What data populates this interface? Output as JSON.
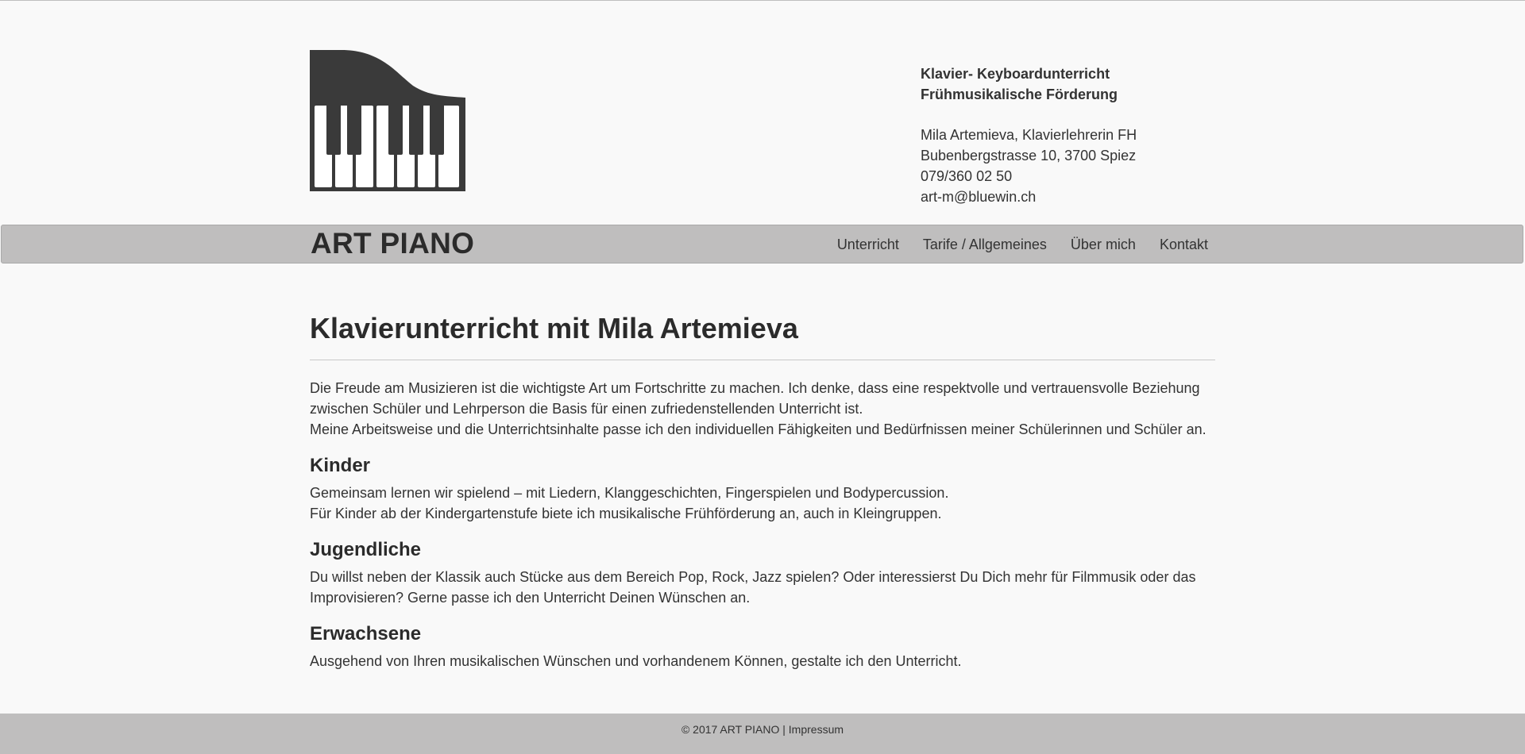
{
  "header": {
    "logo_icon": "grand-piano-icon",
    "contact": {
      "service_line_1": "Klavier- Keyboardunterricht",
      "service_line_2": "Frühmusikalische Förderung",
      "name": "Mila Artemieva, Klavierlehrerin FH",
      "address": "Bubenbergstrasse 10, 3700 Spiez",
      "phone": "079/360 02 50",
      "email": "art-m@bluewin.ch"
    }
  },
  "nav": {
    "brand": "ART PIANO",
    "items": [
      {
        "label": "Unterricht"
      },
      {
        "label": "Tarife / Allgemeines"
      },
      {
        "label": "Über mich"
      },
      {
        "label": "Kontakt"
      }
    ]
  },
  "main": {
    "title": "Klavierunterricht mit Mila Artemieva",
    "intro": [
      "Die Freude am Musizieren ist die wichtigste Art um Fortschritte zu machen. Ich denke, dass eine respektvolle und vertrauensvolle Beziehung zwischen Schüler und Lehrperson die Basis für einen zufriedenstellenden Unterricht ist.",
      "Meine Arbeitsweise und die Unterrichtsinhalte passe ich den individuellen Fähigkeiten und Bedürfnissen meiner Schülerinnen und Schüler an."
    ],
    "sections": [
      {
        "heading": "Kinder",
        "lines": [
          "Gemeinsam lernen wir spielend – mit Liedern, Klanggeschichten, Fingerspielen und Bodypercussion.",
          "Für Kinder ab der Kindergartenstufe biete ich musikalische Frühförderung an, auch in Kleingruppen."
        ]
      },
      {
        "heading": "Jugendliche",
        "lines": [
          "Du willst neben der Klassik auch Stücke aus dem Bereich Pop, Rock, Jazz spielen? Oder interessierst Du Dich mehr für Filmmusik oder das Improvisieren? Gerne passe ich den Unterricht Deinen Wünschen an."
        ]
      },
      {
        "heading": "Erwachsene",
        "lines": [
          "Ausgehend von Ihren musikalischen Wünschen und vorhandenem Können, gestalte ich den Unterricht."
        ]
      }
    ]
  },
  "footer": {
    "copyright": "© 2017 ART PIANO |",
    "impressum": "Impressum"
  },
  "colors": {
    "background": "#f9f9f9",
    "bar": "#bfbebe",
    "text": "#333333",
    "logo": "#3a3a3a"
  }
}
